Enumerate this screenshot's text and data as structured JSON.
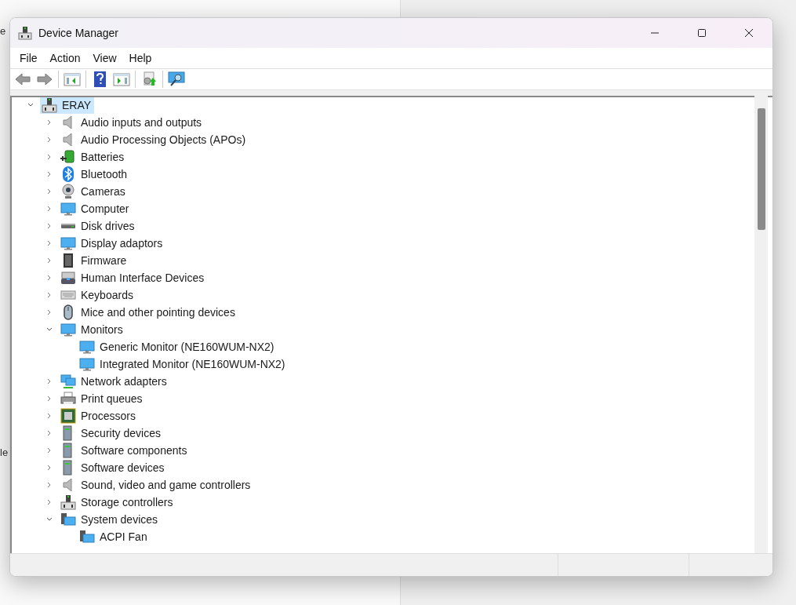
{
  "background": {
    "texts": [
      "e",
      "le"
    ]
  },
  "window": {
    "title": "Device Manager"
  },
  "menu": [
    "File",
    "Action",
    "View",
    "Help"
  ],
  "tree": [
    {
      "label": "ERAY",
      "expanded": true,
      "selected": true,
      "children": [
        {
          "label": "Audio inputs and outputs",
          "expanded": false,
          "selected": false
        },
        {
          "label": "Audio Processing Objects (APOs)",
          "expanded": false,
          "selected": false
        },
        {
          "label": "Batteries",
          "expanded": false,
          "selected": false
        },
        {
          "label": "Bluetooth",
          "expanded": false,
          "selected": false
        },
        {
          "label": "Cameras",
          "expanded": false,
          "selected": false
        },
        {
          "label": "Computer",
          "expanded": false,
          "selected": false
        },
        {
          "label": "Disk drives",
          "expanded": false,
          "selected": false
        },
        {
          "label": "Display adaptors",
          "expanded": false,
          "selected": false
        },
        {
          "label": "Firmware",
          "expanded": false,
          "selected": false
        },
        {
          "label": "Human Interface Devices",
          "expanded": false,
          "selected": false
        },
        {
          "label": "Keyboards",
          "expanded": false,
          "selected": false
        },
        {
          "label": "Mice and other pointing devices",
          "expanded": false,
          "selected": false
        },
        {
          "label": "Monitors",
          "expanded": true,
          "selected": false,
          "children": [
            {
              "label": "Generic Monitor (NE160WUM-NX2)",
              "selected": false
            },
            {
              "label": "Integrated Monitor (NE160WUM-NX2)",
              "selected": false
            }
          ]
        },
        {
          "label": "Network adapters",
          "expanded": false,
          "selected": false
        },
        {
          "label": "Print queues",
          "expanded": false,
          "selected": false
        },
        {
          "label": "Processors",
          "expanded": false,
          "selected": false
        },
        {
          "label": "Security devices",
          "expanded": false,
          "selected": false
        },
        {
          "label": "Software components",
          "expanded": false,
          "selected": false
        },
        {
          "label": "Software devices",
          "expanded": false,
          "selected": false
        },
        {
          "label": "Sound, video and game controllers",
          "expanded": false,
          "selected": false
        },
        {
          "label": "Storage controllers",
          "expanded": false,
          "selected": false
        },
        {
          "label": "System devices",
          "expanded": true,
          "selected": false,
          "children": [
            {
              "label": "ACPI Fan",
              "selected": false
            }
          ]
        }
      ]
    }
  ]
}
